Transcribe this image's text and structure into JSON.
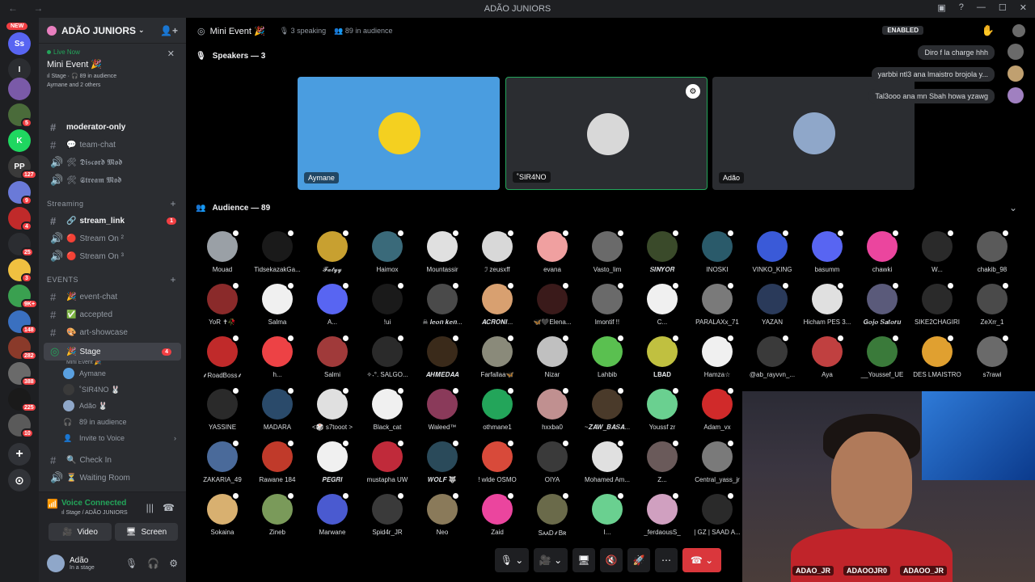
{
  "window": {
    "title": "ADÃO JUNIORS"
  },
  "rail": {
    "new_badge": "NEW",
    "servers": [
      {
        "label": "Ss",
        "color": "#5865f2"
      },
      {
        "label": "I",
        "color": "#2b2d31"
      },
      {
        "label": "",
        "color": "#7a5aa8",
        "badge": ""
      },
      {
        "label": "",
        "color": "#4a6b3a",
        "badge": "5"
      },
      {
        "label": "K",
        "color": "#1fd760",
        "badge": ""
      },
      {
        "label": "PP",
        "color": "#3a3a3a",
        "badge": "127"
      },
      {
        "label": "",
        "color": "#6a7ad8",
        "badge": "9"
      },
      {
        "label": "",
        "color": "#c02a2a",
        "badge": "4"
      },
      {
        "label": "",
        "color": "#2b2d31",
        "badge": "25"
      },
      {
        "label": "",
        "color": "#f0c040",
        "badge": "3"
      },
      {
        "label": "",
        "color": "#3aa050",
        "badge": "9K+"
      },
      {
        "label": "",
        "color": "#3a70c0",
        "badge": "148"
      },
      {
        "label": "",
        "color": "#8a3a2a",
        "badge": "282"
      },
      {
        "label": "",
        "color": "#6a6a6a",
        "badge": "388"
      },
      {
        "label": "",
        "color": "#1a1a1a",
        "badge": "225"
      },
      {
        "label": "",
        "color": "#5a5a5a",
        "badge": "10"
      }
    ],
    "add_icon": "+",
    "discover_icon": "⊙"
  },
  "sidebar": {
    "guild_name": "ADÃO JUNIORS",
    "live": {
      "status": "Live Now",
      "event": "Mini Event 🎉",
      "stage_info": "ıl Stage · 🎧 89 in audience",
      "others": "Aymane and 2 others"
    },
    "channels_top": [
      {
        "name": "moderator-only",
        "bold": true,
        "emo": "",
        "hash": "#"
      },
      {
        "name": "team-chat",
        "bold": false,
        "emo": "💬",
        "hash": "#"
      },
      {
        "name": "𝕯𝖎𝖘𝖈𝖔𝖗𝖉 𝕸𝖔𝖉",
        "bold": false,
        "emo": "🛠",
        "hash": "🔊"
      },
      {
        "name": "𝕾𝖙𝖗𝖊𝖆𝖒 𝕸𝖔𝖉",
        "bold": false,
        "emo": "🛠",
        "hash": "🔊"
      }
    ],
    "cat_streaming": "Streaming",
    "channels_streaming": [
      {
        "name": "stream_link",
        "emo": "🔗",
        "hash": "#",
        "count": "1",
        "bold": true
      },
      {
        "name": "Stream On ²",
        "emo": "🔴",
        "hash": "🔊",
        "count": "",
        "bold": false
      },
      {
        "name": "Stream On ³",
        "emo": "🔴",
        "hash": "🔊",
        "count": "",
        "bold": false
      }
    ],
    "cat_events": "EVENTS",
    "channels_events": [
      {
        "name": "event-chat",
        "emo": "🎉",
        "hash": "#"
      },
      {
        "name": "accepted",
        "emo": "✅",
        "hash": "#"
      },
      {
        "name": "art-showcase",
        "emo": "🎨",
        "hash": "#"
      }
    ],
    "stage": {
      "name": "Stage",
      "sub": "Mini Event 🎉",
      "count": "4"
    },
    "stage_users": [
      {
        "name": "Aymane",
        "color": "#5aa0e0"
      },
      {
        "name": "˚SIR4NO 🐰",
        "color": "#3a3a3a"
      },
      {
        "name": "Adão 🐰",
        "color": "#8fa7c9"
      }
    ],
    "audience_line": "89 in audience",
    "invite": "Invite to Voice",
    "channels_bottom": [
      {
        "name": "Check In",
        "emo": "🔍",
        "hash": "#"
      },
      {
        "name": "Waiting Room",
        "emo": "⏳",
        "hash": "🔊"
      }
    ],
    "voice": {
      "status": "Voice Connected",
      "where": "ıl Stage / ADÃO JUNIORS",
      "video": "Video",
      "screen": "Screen"
    },
    "user": {
      "name": "Adão",
      "status": "In a stage"
    }
  },
  "stage_header": {
    "title": "Mini Event 🎉",
    "speaking": "3 speaking",
    "audience": "89 in audience",
    "enabled": "ENABLED"
  },
  "speakers_title": "Speakers — 3",
  "speakers": [
    {
      "name": "Aymane",
      "bg": "#4a9de0",
      "face": "#f4d020"
    },
    {
      "name": "˚SIR4NO",
      "bg": "#2b2d31",
      "face": "#d8d8d8"
    },
    {
      "name": "Adão",
      "bg": "#2b2d31",
      "face": "#8fa7c9"
    }
  ],
  "audience_title": "Audience — 89",
  "audience": [
    {
      "n": "Mouad",
      "c": "#9aa0a6"
    },
    {
      "n": "TidsekazakGa...",
      "c": "#1a1a1a"
    },
    {
      "n": "𝓕𝓪𝓽𝔂𝔂",
      "c": "#c8a030"
    },
    {
      "n": "Haimox",
      "c": "#3a6a7a"
    },
    {
      "n": "Mountassir",
      "c": "#e0e0e0"
    },
    {
      "n": "ℐ zeusxff",
      "c": "#d8d8d8"
    },
    {
      "n": "evana",
      "c": "#f0a0a0"
    },
    {
      "n": "Vasto_lim",
      "c": "#6a6a6a"
    },
    {
      "n": "𝑺𝑰𝑵𝒀𝑶𝑹",
      "c": "#3a4a2a"
    },
    {
      "n": "INOSKI",
      "c": "#2a5a6a"
    },
    {
      "n": "VINKO_KING",
      "c": "#3a5ad8"
    },
    {
      "n": "basumm",
      "c": "#5865f2"
    },
    {
      "n": "chawki",
      "c": "#eb459e"
    },
    {
      "n": "W...",
      "c": "#2a2a2a"
    },
    {
      "n": "chakib_98",
      "c": "#5a5a5a"
    },
    {
      "n": "YoR ✝🥀",
      "c": "#8a2a2a"
    },
    {
      "n": "Salma",
      "c": "#f0f0f0"
    },
    {
      "n": "A...",
      "c": "#5865f2"
    },
    {
      "n": "!ui",
      "c": "#1a1a1a"
    },
    {
      "n": "☠ 𝒍𝒆𝒐𝒏 𝒌𝒆𝒏...",
      "c": "#4a4a4a"
    },
    {
      "n": "𝑨𝑪𝑹𝑶𝑵𝑰...",
      "c": "#d8a070"
    },
    {
      "n": "🦋🖤Elena...",
      "c": "#3a1a1a"
    },
    {
      "n": "lmontif !!",
      "c": "#6a6a6a"
    },
    {
      "n": "C...",
      "c": "#f0f0f0"
    },
    {
      "n": "PARALAXx_71",
      "c": "#7a7a7a"
    },
    {
      "n": "YAZAN",
      "c": "#2a3a5a"
    },
    {
      "n": "Hicham PES 3...",
      "c": "#e0e0e0"
    },
    {
      "n": "𝑮𝒐𝒋𝒐 𝑺𝒂𝒕𝒐𝒓𝒖",
      "c": "#5a5a7a"
    },
    {
      "n": "SIKE2CHAGIRI",
      "c": "#2a2a2a"
    },
    {
      "n": "ZeXrr_1",
      "c": "#4a4a4a"
    },
    {
      "n": "⸙RoadBoss⸙",
      "c": "#c02a2a"
    },
    {
      "n": "h...",
      "c": "#ed4245"
    },
    {
      "n": "Salmi",
      "c": "#a03a3a"
    },
    {
      "n": "✧˖°. SALGO...",
      "c": "#2a2a2a"
    },
    {
      "n": "𝑨𝑯𝑴𝑬𝑫𝑨𝑨",
      "c": "#3a2a1a"
    },
    {
      "n": "Farfallaa🦋",
      "c": "#8a8a7a"
    },
    {
      "n": "Nizar",
      "c": "#c0c0c0"
    },
    {
      "n": "Lahbib",
      "c": "#5ac050"
    },
    {
      "n": "𝐋𝐁𝐀𝐃",
      "c": "#c0c040"
    },
    {
      "n": "Hamza☆",
      "c": "#f0f0f0"
    },
    {
      "n": "@ab_rayvvn_...",
      "c": "#3a3a3a"
    },
    {
      "n": "Aya",
      "c": "#c04040"
    },
    {
      "n": "__Youssef_UE",
      "c": "#3a7a3a"
    },
    {
      "n": "DES LMAISTRO",
      "c": "#e0a030"
    },
    {
      "n": "s7rawi",
      "c": "#6a6a6a"
    },
    {
      "n": "YASSINE",
      "c": "#2a2a2a"
    },
    {
      "n": "MADARA",
      "c": "#2a4a6a"
    },
    {
      "n": "<🎲 s7tooot >",
      "c": "#e0e0e0"
    },
    {
      "n": "Black_cat",
      "c": "#f0f0f0"
    },
    {
      "n": "Waleed™",
      "c": "#8a3a5a"
    },
    {
      "n": "othmane1",
      "c": "#23a55a"
    },
    {
      "n": "hxxba0",
      "c": "#c09090"
    },
    {
      "n": "~𝒁𝑨𝑾_𝑩𝑨𝑺𝑨...",
      "c": "#4a3a2a"
    },
    {
      "n": "Youssf zr",
      "c": "#6ad090"
    },
    {
      "n": "Adam_vx",
      "c": "#d02a2a"
    },
    {
      "n": "ZAKARIA_49",
      "c": "#4a6a9a"
    },
    {
      "n": "Rawane 184",
      "c": "#c03a2a"
    },
    {
      "n": "𝑷𝑬𝑮𝑹𝑰",
      "c": "#f0f0f0"
    },
    {
      "n": "mustapha UW",
      "c": "#c02a3a"
    },
    {
      "n": "𝑾𝑶𝑳𝑭 🐺",
      "c": "#2a4a5a"
    },
    {
      "n": "! wlde OSMO",
      "c": "#d84a3a"
    },
    {
      "n": "OIYA",
      "c": "#3a3a3a"
    },
    {
      "n": "Mohamed Am...",
      "c": "#e0e0e0"
    },
    {
      "n": "Z...",
      "c": "#6a5a5a"
    },
    {
      "n": "Central_yass_jr",
      "c": "#7a7a7a"
    },
    {
      "n": "Sokaina",
      "c": "#d8b070"
    },
    {
      "n": "Zineb",
      "c": "#7a9a5a"
    },
    {
      "n": "Marwane",
      "c": "#4a5ad0"
    },
    {
      "n": "Spid4r_JR",
      "c": "#3a3a3a"
    },
    {
      "n": "Neo",
      "c": "#8a7a5a"
    },
    {
      "n": "Zaid",
      "c": "#eb459e"
    },
    {
      "n": "SᴀᴀD⸙Bʀ",
      "c": "#6a6a4a"
    },
    {
      "n": "I...",
      "c": "#6ad090"
    },
    {
      "n": "_ferdaousS_",
      "c": "#d0a0c0"
    },
    {
      "n": "| GZ | SAAD A...",
      "c": "#2a2a2a"
    }
  ],
  "chat": [
    {
      "text": "Diro f la charge hhh",
      "color": "#6a6a6a"
    },
    {
      "text": "yarbbi ntl3 ana lmaistro brojola y...",
      "color": "#c0a070"
    },
    {
      "text": "Tal3ooo ana mn Sbah howa yzawg",
      "color": "#a080c0"
    }
  ],
  "socials": [
    "ADAO_JR",
    "ADAOOJR0",
    "ADAOO_JR"
  ]
}
